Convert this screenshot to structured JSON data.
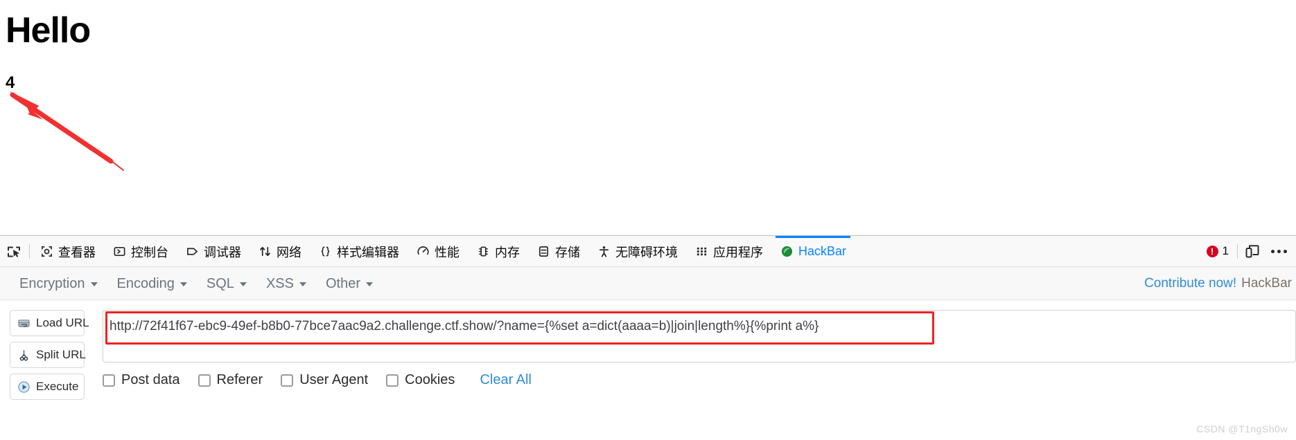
{
  "page": {
    "title": "Hello",
    "value": "4",
    "annotation": {
      "type": "red-arrow",
      "color": "#f23030"
    }
  },
  "devtools": {
    "picker_icon": "element-picker-icon",
    "tabs": [
      {
        "label": "查看器",
        "icon": "inspector-icon",
        "active": false
      },
      {
        "label": "控制台",
        "icon": "console-icon",
        "active": false
      },
      {
        "label": "调试器",
        "icon": "debugger-icon",
        "active": false
      },
      {
        "label": "网络",
        "icon": "network-icon",
        "active": false
      },
      {
        "label": "样式编辑器",
        "icon": "style-editor-icon",
        "active": false
      },
      {
        "label": "性能",
        "icon": "performance-icon",
        "active": false
      },
      {
        "label": "内存",
        "icon": "memory-icon",
        "active": false
      },
      {
        "label": "存储",
        "icon": "storage-icon",
        "active": false
      },
      {
        "label": "无障碍环境",
        "icon": "accessibility-icon",
        "active": false
      },
      {
        "label": "应用程序",
        "icon": "application-icon",
        "active": false
      },
      {
        "label": "HackBar",
        "icon": "hackbar-icon",
        "active": true
      }
    ],
    "error_count": "1",
    "responsive_icon": "responsive-design-mode-icon",
    "more_icon": "more-options-icon",
    "active_tab_color": "#0a84ff",
    "error_color": "#d70022"
  },
  "hackbar": {
    "menus": [
      {
        "label": "Encryption"
      },
      {
        "label": "Encoding"
      },
      {
        "label": "SQL"
      },
      {
        "label": "XSS"
      },
      {
        "label": "Other"
      }
    ],
    "contribute_link": "Contribute now!",
    "brand": "HackBar",
    "buttons": [
      {
        "label": "Load URL",
        "icon": "load-url-icon"
      },
      {
        "label": "Split URL",
        "icon": "split-url-scissors-icon"
      },
      {
        "label": "Execute",
        "icon": "execute-play-icon"
      }
    ],
    "url_value": "http://72f41f67-ebc9-49ef-b8b0-77bce7aac9a2.challenge.ctf.show/?name={%set a=dict(aaaa=b)|join|length%}{%print a%}",
    "url_placeholder": "",
    "options": [
      {
        "label": "Post data",
        "checked": false
      },
      {
        "label": "Referer",
        "checked": false
      },
      {
        "label": "User Agent",
        "checked": false
      },
      {
        "label": "Cookies",
        "checked": false
      }
    ],
    "clear_all": "Clear All",
    "link_color": "#2e8bd8"
  },
  "watermark": "CSDN @T1ngSh0w"
}
